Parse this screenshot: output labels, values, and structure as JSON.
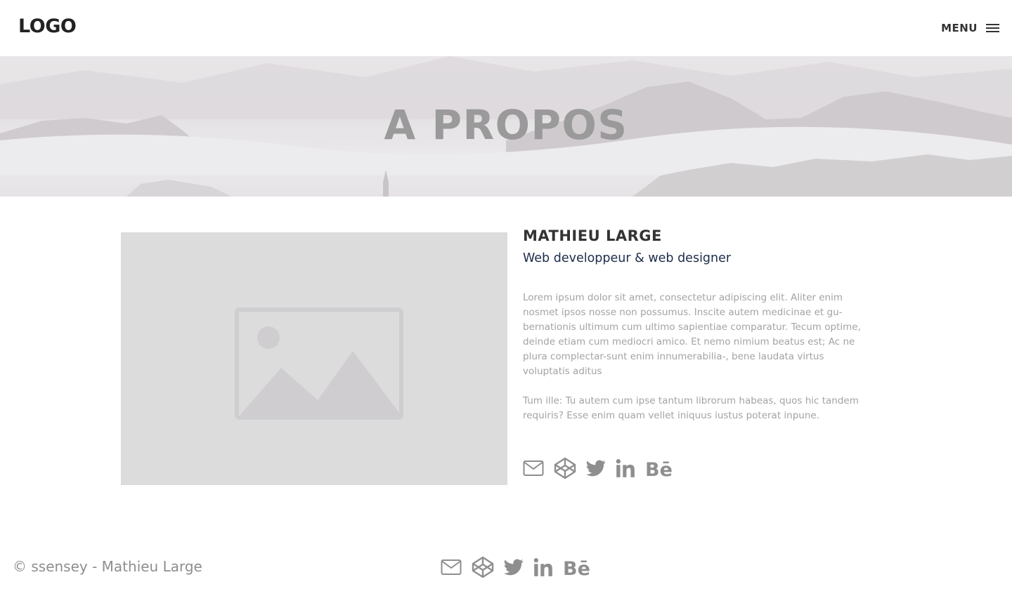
{
  "header": {
    "logo": "LOGO",
    "menu_label": "MENU",
    "menu_icon": "hamburger-icon"
  },
  "hero": {
    "title": "A PROPOS"
  },
  "profile": {
    "photo_icon": "image-placeholder-icon",
    "name": "MATHIEU LARGE",
    "role": "Web developpeur & web designer",
    "bio": [
      "Lorem ipsum dolor sit amet, consectetur adipiscing elit. Aliter enim nosmet ipsos nosse non possumus. Inscite autem medicinae et gu-bernationis ultimum cum ultimo sapientiae comparatur. Tecum optime, deinde etiam cum mediocri amico. Et nemo nimium beatus est; Ac ne plura complectar-sunt enim innumerabilia-, bene laudata virtus voluptatis aditus",
      "Tum ille: Tu autem cum ipse tantum librorum habeas, quos hic tandem requiris? Esse enim quam vellet iniquus iustus poterat inpune."
    ],
    "social": [
      "mail-icon",
      "codepen-icon",
      "twitter-icon",
      "linkedin-icon",
      "behance-icon"
    ]
  },
  "footer": {
    "copyright": "© ssensey - Mathieu Large",
    "social": [
      "mail-icon",
      "codepen-icon",
      "twitter-icon",
      "linkedin-icon",
      "behance-icon"
    ]
  },
  "colors": {
    "text_dark": "#333333",
    "role_blue": "#1d2c4a",
    "muted": "#a3a3a3",
    "icon_grey": "#8e8e8e",
    "placeholder_bg": "#dcdcdd"
  }
}
